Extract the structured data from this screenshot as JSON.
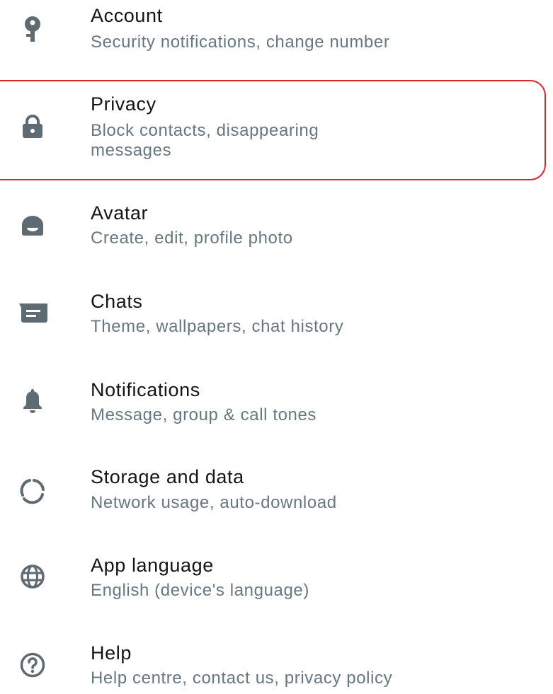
{
  "settings": {
    "items": [
      {
        "id": "account",
        "title": "Account",
        "subtitle": "Security notifications, change number",
        "icon": "key-icon"
      },
      {
        "id": "privacy",
        "title": "Privacy",
        "subtitle": "Block contacts, disappearing messages",
        "icon": "lock-icon"
      },
      {
        "id": "avatar",
        "title": "Avatar",
        "subtitle": "Create, edit, profile photo",
        "icon": "avatar-icon"
      },
      {
        "id": "chats",
        "title": "Chats",
        "subtitle": "Theme, wallpapers, chat history",
        "icon": "chat-icon"
      },
      {
        "id": "notifications",
        "title": "Notifications",
        "subtitle": "Message, group & call tones",
        "icon": "bell-icon"
      },
      {
        "id": "storage",
        "title": "Storage and data",
        "subtitle": "Network usage, auto-download",
        "icon": "storage-circle-icon"
      },
      {
        "id": "language",
        "title": "App language",
        "subtitle": "English (device's language)",
        "icon": "globe-icon"
      },
      {
        "id": "help",
        "title": "Help",
        "subtitle": "Help centre, contact us, privacy policy",
        "icon": "help-circle-icon"
      }
    ]
  },
  "colors": {
    "icon": "#5f6b72",
    "title": "#141414",
    "subtitle": "#667781",
    "highlight": "#d9262c"
  }
}
